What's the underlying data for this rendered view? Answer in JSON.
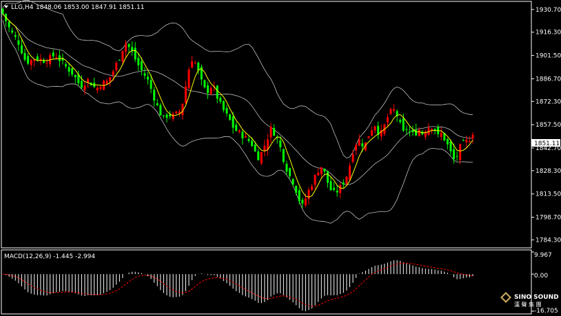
{
  "header": {
    "symbol": "LLG,H4",
    "ohlc": "1848.06 1853.00 1847.91 1851.11"
  },
  "current_price_label": "1851.11",
  "macd": {
    "title": "MACD(12,26,9) -1.445 -2.994",
    "axis_labels": [
      "9.967",
      "0.00",
      "-16.705"
    ]
  },
  "logo": {
    "brand": "SINO SOUND",
    "sub": "漢 聲 集 團"
  },
  "colors": {
    "background": "#000000",
    "bull_candle": "#ff0000",
    "bear_candle": "#00ff00",
    "moving_average": "#ffff00",
    "bollinger_bands": "#c0c0c0",
    "macd_histogram": "#ffffff",
    "macd_signal": "#ff0000",
    "axis": "#ffffff"
  },
  "chart_data": [
    {
      "type": "candlestick",
      "symbol": "LLG",
      "timeframe": "H4",
      "y_tick_labels": [
        "1930.70",
        "1916.30",
        "1901.50",
        "1886.70",
        "1872.30",
        "1857.50",
        "1842.70",
        "1828.30",
        "1813.50",
        "1798.70",
        "1784.30"
      ],
      "ylim": [
        1781,
        1935
      ],
      "last_price": 1851.11,
      "overlays": [
        "Bollinger Bands",
        "Moving Average"
      ],
      "close_path": [
        [
          0,
          1928
        ],
        [
          4,
          1917
        ],
        [
          8,
          1910
        ],
        [
          12,
          1897
        ],
        [
          17,
          1900
        ],
        [
          22,
          1898
        ],
        [
          27,
          1902
        ],
        [
          32,
          1895
        ],
        [
          36,
          1890
        ],
        [
          40,
          1882
        ],
        [
          44,
          1886
        ],
        [
          48,
          1880
        ],
        [
          51,
          1884
        ],
        [
          54,
          1885
        ],
        [
          57,
          1892
        ],
        [
          60,
          1900
        ],
        [
          63,
          1910
        ],
        [
          66,
          1905
        ],
        [
          69,
          1897
        ],
        [
          72,
          1891
        ],
        [
          75,
          1885
        ],
        [
          77,
          1878
        ],
        [
          79,
          1871
        ],
        [
          81,
          1865
        ],
        [
          83,
          1861
        ],
        [
          85,
          1864
        ],
        [
          88,
          1863
        ],
        [
          91,
          1866
        ],
        [
          93,
          1873
        ],
        [
          95,
          1888
        ],
        [
          97,
          1900
        ],
        [
          99,
          1897
        ],
        [
          101,
          1890
        ],
        [
          103,
          1882
        ],
        [
          105,
          1878
        ],
        [
          107,
          1882
        ],
        [
          109,
          1880
        ],
        [
          111,
          1873
        ],
        [
          113,
          1868
        ],
        [
          115,
          1864
        ],
        [
          117,
          1860
        ],
        [
          119,
          1855
        ],
        [
          122,
          1852
        ],
        [
          125,
          1849
        ],
        [
          128,
          1846
        ],
        [
          130,
          1840
        ],
        [
          132,
          1836
        ],
        [
          134,
          1842
        ],
        [
          136,
          1848
        ],
        [
          138,
          1855
        ],
        [
          140,
          1852
        ],
        [
          142,
          1847
        ],
        [
          144,
          1838
        ],
        [
          146,
          1830
        ],
        [
          148,
          1824
        ],
        [
          150,
          1820
        ],
        [
          152,
          1812
        ],
        [
          154,
          1805
        ],
        [
          156,
          1811
        ],
        [
          158,
          1817
        ],
        [
          160,
          1822
        ],
        [
          162,
          1828
        ],
        [
          164,
          1831
        ],
        [
          166,
          1826
        ],
        [
          168,
          1818
        ],
        [
          170,
          1814
        ],
        [
          172,
          1815
        ],
        [
          174,
          1818
        ],
        [
          176,
          1822
        ],
        [
          178,
          1828
        ],
        [
          180,
          1840
        ],
        [
          182,
          1846
        ],
        [
          184,
          1848
        ],
        [
          186,
          1843
        ],
        [
          188,
          1850
        ],
        [
          190,
          1855
        ],
        [
          192,
          1858
        ],
        [
          194,
          1850
        ],
        [
          196,
          1855
        ],
        [
          198,
          1862
        ],
        [
          200,
          1866
        ],
        [
          202,
          1867
        ],
        [
          204,
          1860
        ],
        [
          206,
          1852
        ],
        [
          208,
          1855
        ],
        [
          210,
          1852
        ],
        [
          212,
          1851
        ],
        [
          214,
          1855
        ],
        [
          216,
          1852
        ],
        [
          218,
          1855
        ],
        [
          220,
          1857
        ],
        [
          222,
          1856
        ],
        [
          224,
          1850
        ],
        [
          226,
          1852
        ],
        [
          228,
          1847
        ],
        [
          230,
          1842
        ],
        [
          232,
          1835
        ],
        [
          234,
          1838
        ],
        [
          236,
          1845
        ],
        [
          238,
          1846
        ],
        [
          240,
          1848
        ],
        [
          242,
          1851.11
        ]
      ]
    },
    {
      "type": "bar",
      "name": "MACD(12,26,9)",
      "macd_value": -1.445,
      "signal_value": -2.994,
      "y_tick_labels": [
        "9.967",
        "0.00",
        "-16.705"
      ],
      "ylim": [
        -16.705,
        9.967
      ]
    }
  ]
}
